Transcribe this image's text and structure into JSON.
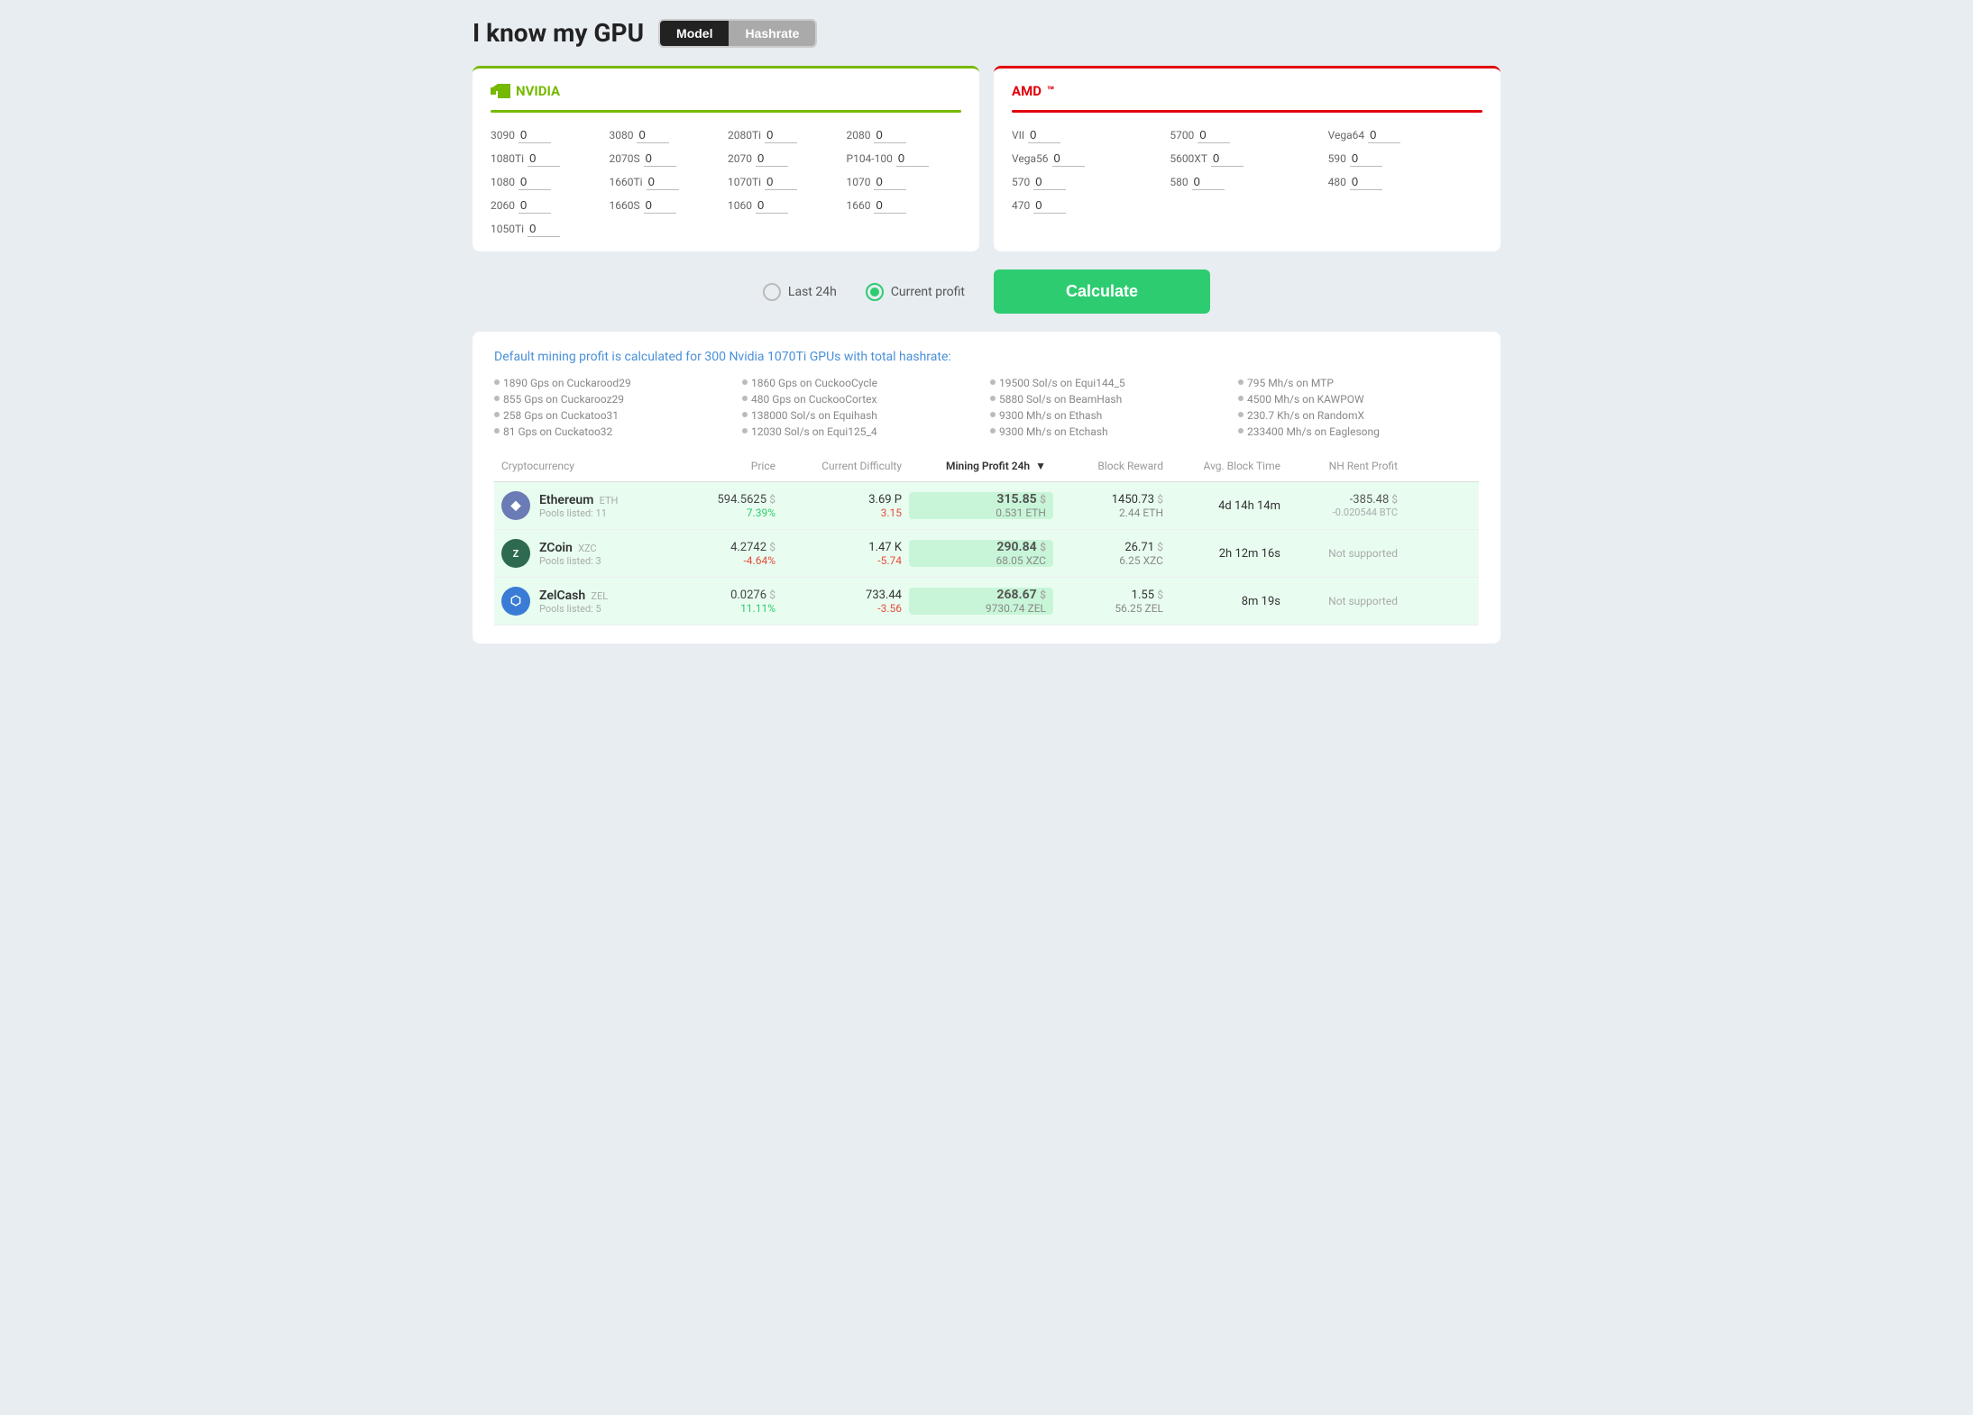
{
  "header": {
    "title": "I know my GPU",
    "toggle": {
      "option1": "Model",
      "option2": "Hashrate",
      "active": "Model"
    }
  },
  "nvidia": {
    "brand": "NVIDIA",
    "gpus": [
      {
        "label": "3090",
        "value": "0"
      },
      {
        "label": "3080",
        "value": "0"
      },
      {
        "label": "2080Ti",
        "value": "0"
      },
      {
        "label": "2080",
        "value": "0"
      },
      {
        "label": "1080Ti",
        "value": "0"
      },
      {
        "label": "2070S",
        "value": "0"
      },
      {
        "label": "2070",
        "value": "0"
      },
      {
        "label": "P104-100",
        "value": "0"
      },
      {
        "label": "1080",
        "value": "0"
      },
      {
        "label": "1660Ti",
        "value": "0"
      },
      {
        "label": "1070Ti",
        "value": "0"
      },
      {
        "label": "1070",
        "value": "0"
      },
      {
        "label": "2060",
        "value": "0"
      },
      {
        "label": "1660S",
        "value": "0"
      },
      {
        "label": "1060",
        "value": "0"
      },
      {
        "label": "1660",
        "value": "0"
      },
      {
        "label": "1050Ti",
        "value": "0"
      }
    ]
  },
  "amd": {
    "brand": "AMD",
    "gpus": [
      {
        "label": "VII",
        "value": "0"
      },
      {
        "label": "5700",
        "value": "0"
      },
      {
        "label": "Vega64",
        "value": "0"
      },
      {
        "label": "Vega56",
        "value": "0"
      },
      {
        "label": "5600XT",
        "value": "0"
      },
      {
        "label": "590",
        "value": "0"
      },
      {
        "label": "570",
        "value": "0"
      },
      {
        "label": "580",
        "value": "0"
      },
      {
        "label": "480",
        "value": "0"
      },
      {
        "label": "470",
        "value": "0"
      }
    ]
  },
  "controls": {
    "option1": "Last 24h",
    "option2": "Current profit",
    "active": "Current profit",
    "calc_button": "Calculate"
  },
  "results": {
    "default_text": "Default mining profit is calculated for 300 Nvidia 1070Ti GPUs with total hashrate:",
    "hashrates": [
      "1890 Gps on Cuckarood29",
      "1860 Gps on CuckooCycle",
      "19500 Sol/s on Equi144_5",
      "795 Mh/s on MTP",
      "855 Gps on Cuckarooz29",
      "480 Gps on CuckooCortex",
      "5880 Sol/s on BeamHash",
      "4500 Mh/s on KAWPOW",
      "258 Gps on Cuckatoo31",
      "138000 Sol/s on Equihash",
      "9300 Mh/s on Ethash",
      "230.7 Kh/s on RandomX",
      "81 Gps on Cuckatoo32",
      "12030 Sol/s on Equi125_4",
      "9300 Mh/s on Etchash",
      "233400 Mh/s on Eaglesong"
    ]
  },
  "table": {
    "headers": [
      {
        "label": "Cryptocurrency",
        "key": "crypto"
      },
      {
        "label": "Price",
        "key": "price"
      },
      {
        "label": "Current Difficulty",
        "key": "difficulty"
      },
      {
        "label": "Mining Profit 24h",
        "key": "profit",
        "sorted": true
      },
      {
        "label": "Block Reward",
        "key": "block_reward"
      },
      {
        "label": "Avg. Block Time",
        "key": "avg_block_time"
      },
      {
        "label": "NH Rent Profit",
        "key": "nh_rent"
      }
    ],
    "rows": [
      {
        "highlighted": true,
        "coin": "Ethereum",
        "ticker": "ETH",
        "pools": "11",
        "price": "594.5625",
        "price_dollar": "$",
        "price_change": "7.39%",
        "price_change_type": "green",
        "difficulty": "3.69 P",
        "difficulty_sub": "3.15",
        "difficulty_sub_color": "red",
        "profit": "315.85",
        "profit_dollar": "$",
        "profit_sub": "0.531 ETH",
        "block_reward": "1450.73",
        "block_reward_dollar": "$",
        "block_reward_sub": "2.44 ETH",
        "avg_block_time": "4d 14h 14m",
        "nh_profit": "-385.48",
        "nh_dollar": "$",
        "nh_btc": "-0.020544 BTC"
      },
      {
        "highlighted": true,
        "coin": "ZCoin",
        "ticker": "XZC",
        "pools": "3",
        "price": "4.2742",
        "price_dollar": "$",
        "price_change": "-4.64%",
        "price_change_type": "red",
        "difficulty": "1.47 K",
        "difficulty_sub": "-5.74",
        "difficulty_sub_color": "red",
        "profit": "290.84",
        "profit_dollar": "$",
        "profit_sub": "68.05 XZC",
        "block_reward": "26.71",
        "block_reward_dollar": "$",
        "block_reward_sub": "6.25 XZC",
        "avg_block_time": "2h 12m 16s",
        "nh_profit": "Not supported",
        "nh_dollar": "",
        "nh_btc": ""
      },
      {
        "highlighted": true,
        "coin": "ZelCash",
        "ticker": "ZEL",
        "pools": "5",
        "price": "0.0276",
        "price_dollar": "$",
        "price_change": "11.11%",
        "price_change_type": "green",
        "difficulty": "733.44",
        "difficulty_sub": "-3.56",
        "difficulty_sub_color": "red",
        "profit": "268.67",
        "profit_dollar": "$",
        "profit_sub": "9730.74 ZEL",
        "block_reward": "1.55",
        "block_reward_dollar": "$",
        "block_reward_sub": "56.25 ZEL",
        "avg_block_time": "8m 19s",
        "nh_profit": "Not supported",
        "nh_dollar": "",
        "nh_btc": ""
      }
    ]
  }
}
